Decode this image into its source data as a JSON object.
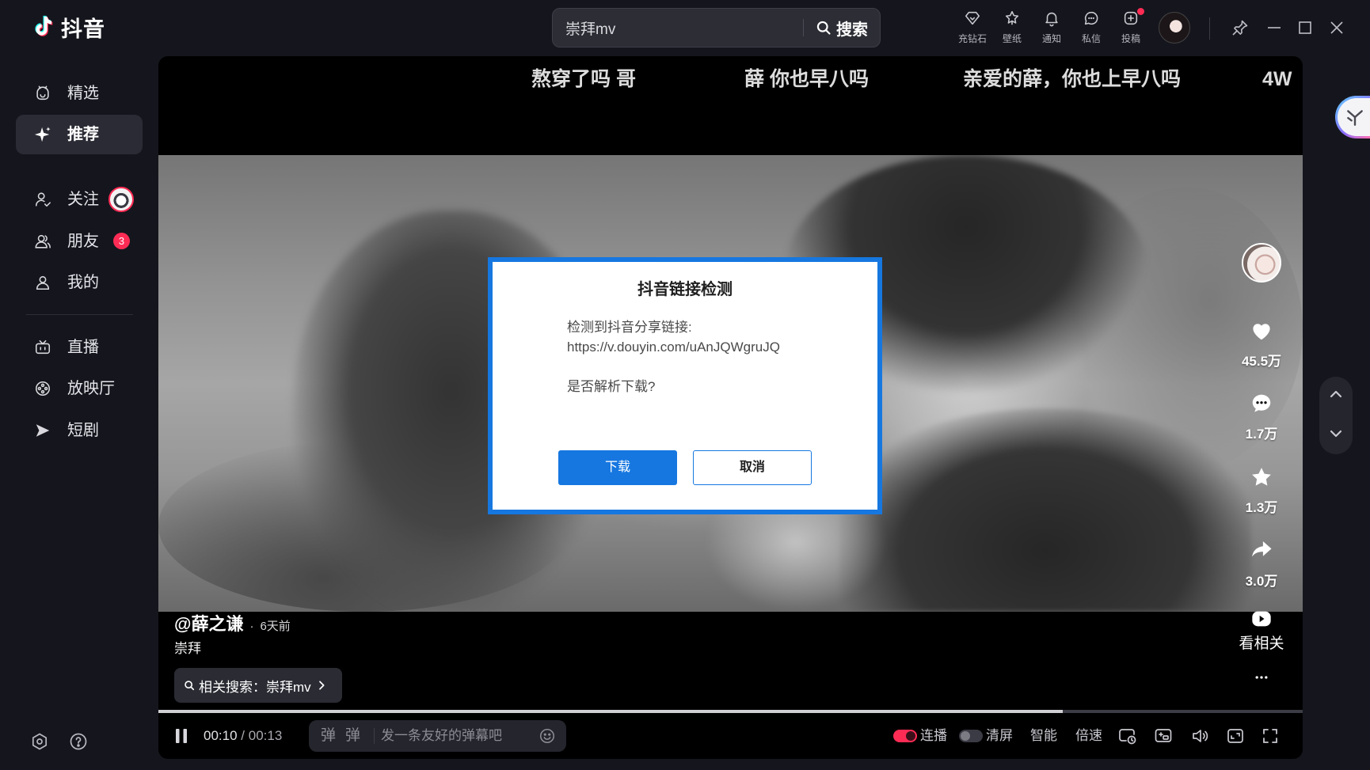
{
  "app": {
    "logo_text": "抖音"
  },
  "search": {
    "value": "崇拜mv",
    "button_label": "搜索",
    "icon": "search-icon"
  },
  "topbar": {
    "items": [
      {
        "label": "充钻石",
        "icon": "diamond-icon"
      },
      {
        "label": "壁纸",
        "icon": "wallpaper-icon"
      },
      {
        "label": "通知",
        "icon": "bell-icon"
      },
      {
        "label": "私信",
        "icon": "message-icon"
      },
      {
        "label": "投稿",
        "icon": "upload-icon",
        "has_dot": true
      }
    ],
    "window_controls": [
      "pin-icon",
      "minimize-icon",
      "maximize-icon",
      "close-icon"
    ]
  },
  "sidebar": {
    "items": [
      {
        "label": "精选",
        "icon": "featured-icon"
      },
      {
        "label": "推荐",
        "icon": "sparkle-icon",
        "active": true
      },
      {
        "label": "关注",
        "icon": "follow-icon"
      },
      {
        "label": "朋友",
        "icon": "friends-icon",
        "badge": "3"
      },
      {
        "label": "我的",
        "icon": "profile-icon"
      },
      {
        "label": "直播",
        "icon": "live-tv-icon"
      },
      {
        "label": "放映厅",
        "icon": "cinema-icon"
      },
      {
        "label": "短剧",
        "icon": "short-drama-icon"
      }
    ],
    "footer_icons": [
      "settings-icon",
      "help-icon"
    ]
  },
  "danmaku": [
    "熬穿了吗 哥",
    "薛 你也早八吗",
    "亲爱的薛，你也上早八吗",
    "4W"
  ],
  "dialog": {
    "title": "抖音链接检测",
    "line1": "检测到抖音分享链接:",
    "link": "https://v.douyin.com/uAnJQWgruJQ",
    "question": "是否解析下载?",
    "confirm_label": "下载",
    "cancel_label": "取消"
  },
  "video": {
    "author": "@薛之谦",
    "separator": "·",
    "posted": "6天前",
    "caption": "崇拜",
    "related_search": "相关搜索：崇拜mv"
  },
  "actions": {
    "likes": "45.5万",
    "comments": "1.7万",
    "favorites": "1.3万",
    "shares": "3.0万",
    "related_label": "看相关"
  },
  "player": {
    "current_time": "00:10",
    "time_separator": "/",
    "duration": "00:13",
    "progress": 0.79,
    "danmaku_toggle_1": "弹",
    "danmaku_toggle_2": "弹",
    "danmaku_placeholder": "发一条友好的弹幕吧",
    "autoplay_label": "连播",
    "autoplay_on": true,
    "clear_label": "清屏",
    "clear_on": false,
    "quality_label": "智能",
    "speed_label": "倍速"
  },
  "colors": {
    "accent": "#fe2c55",
    "dialog_blue": "#1677e0",
    "background": "#15161d"
  }
}
